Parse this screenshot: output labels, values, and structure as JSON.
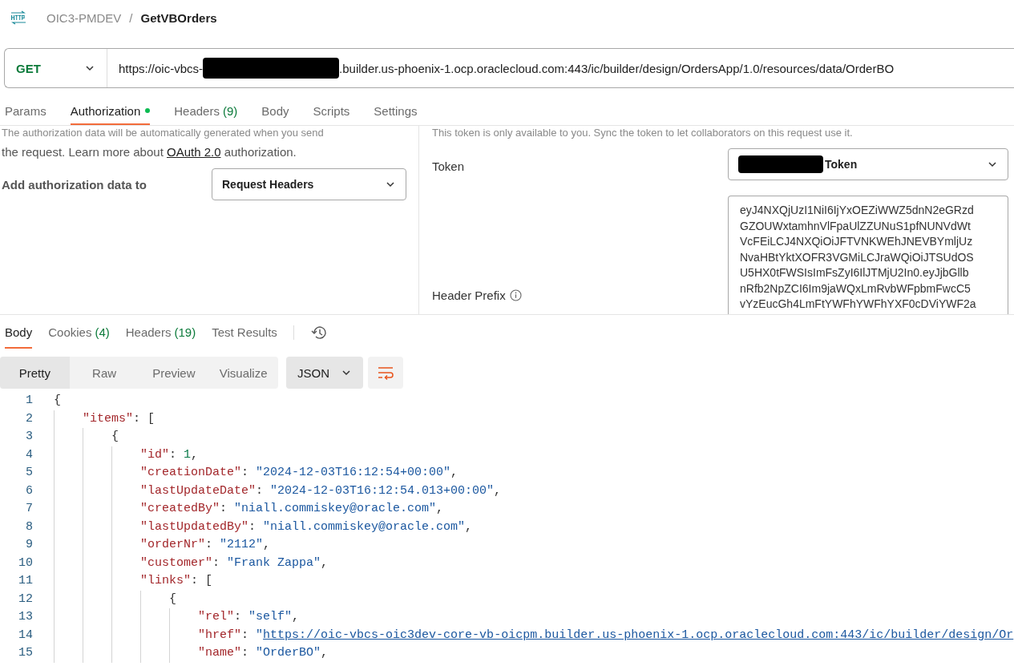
{
  "breadcrumb": {
    "collection": "OIC3-PMDEV",
    "separator": "/",
    "request": "GetVBOrders"
  },
  "request_bar": {
    "method": "GET",
    "url_prefix": "https://oic-vbcs-",
    "url_redacted": true,
    "url_suffix": ".builder.us-phoenix-1.ocp.oraclecloud.com:443/ic/builder/design/OrdersApp/1.0/resources/data/OrderBO"
  },
  "request_tabs": [
    {
      "label": "Params",
      "selected": false,
      "indicator": false
    },
    {
      "label": "Authorization",
      "selected": true,
      "indicator": true
    },
    {
      "label": "Headers",
      "count": "(9)",
      "selected": false,
      "indicator": false
    },
    {
      "label": "Body",
      "selected": false,
      "indicator": false
    },
    {
      "label": "Scripts",
      "selected": false,
      "indicator": false
    },
    {
      "label": "Settings",
      "selected": false,
      "indicator": false
    }
  ],
  "auth": {
    "description_clipped": "The authorization data will be automatically generated when you send",
    "description_before": "the request. Learn more about",
    "description_link": "OAuth 2.0",
    "description_after": "authorization.",
    "add_to_label": "Add authorization data to",
    "add_to_value": "Request Headers",
    "note_clipped": "This token is only available to you. Sync the token to let collaborators on this request use it.",
    "token_label": "Token",
    "token_redacted": true,
    "token_value": "Token",
    "header_prefix_label": "Header Prefix",
    "token_lines": [
      "eyJ4NXQjUzI1NiI6IjYxOEZiWWZ5dnN2eGRzd",
      "GZOUWxtamhnVlFpaUlZZUNuS1pfNUNVdWt",
      "VcFEiLCJ4NXQiOiJFTVNKWEhJNEVBYmljUz",
      "NvaHBtYktXOFR3VGMiLCJraWQiOiJTSUdOS",
      "U5HX0tFWSIsImFsZyI6IlJTMjU2In0.eyJjbGllb",
      "nRfb2NpZCI6Im9jaWQxLmRvbWFpbmFwcC5",
      "vYzEucGh4LmFtYWFhYWFhYXF0cDViYWF2a"
    ]
  },
  "response_tabs": [
    {
      "label": "Body",
      "selected": true
    },
    {
      "label": "Cookies",
      "count": "(4)",
      "selected": false
    },
    {
      "label": "Headers",
      "count": "(19)",
      "selected": false
    },
    {
      "label": "Test Results",
      "selected": false
    }
  ],
  "view_modes": [
    {
      "label": "Pretty",
      "selected": true
    },
    {
      "label": "Raw",
      "selected": false
    },
    {
      "label": "Preview",
      "selected": false
    },
    {
      "label": "Visualize",
      "selected": false
    }
  ],
  "format": "JSON",
  "code_lines": [
    {
      "number": "1",
      "tokens": [
        {
          "kind": "punct",
          "text": "{"
        }
      ]
    },
    {
      "number": "2",
      "tokens": [
        {
          "kind": "key",
          "text": "    \"items\""
        },
        {
          "kind": "punct",
          "text": ": ["
        }
      ]
    },
    {
      "number": "3",
      "tokens": [
        {
          "kind": "punct",
          "text": "        {"
        }
      ]
    },
    {
      "number": "4",
      "tokens": [
        {
          "kind": "key",
          "text": "            \"id\""
        },
        {
          "kind": "punct",
          "text": ": "
        },
        {
          "kind": "number",
          "text": "1"
        },
        {
          "kind": "punct",
          "text": ","
        }
      ]
    },
    {
      "number": "5",
      "tokens": [
        {
          "kind": "key",
          "text": "            \"creationDate\""
        },
        {
          "kind": "punct",
          "text": ": "
        },
        {
          "kind": "string",
          "text": "\"2024-12-03T16:12:54+00:00\""
        },
        {
          "kind": "punct",
          "text": ","
        }
      ]
    },
    {
      "number": "6",
      "tokens": [
        {
          "kind": "key",
          "text": "            \"lastUpdateDate\""
        },
        {
          "kind": "punct",
          "text": ": "
        },
        {
          "kind": "string",
          "text": "\"2024-12-03T16:12:54.013+00:00\""
        },
        {
          "kind": "punct",
          "text": ","
        }
      ]
    },
    {
      "number": "7",
      "tokens": [
        {
          "kind": "key",
          "text": "            \"createdBy\""
        },
        {
          "kind": "punct",
          "text": ": "
        },
        {
          "kind": "string",
          "text": "\"niall.commiskey@oracle.com\""
        },
        {
          "kind": "punct",
          "text": ","
        }
      ]
    },
    {
      "number": "8",
      "tokens": [
        {
          "kind": "key",
          "text": "            \"lastUpdatedBy\""
        },
        {
          "kind": "punct",
          "text": ": "
        },
        {
          "kind": "string",
          "text": "\"niall.commiskey@oracle.com\""
        },
        {
          "kind": "punct",
          "text": ","
        }
      ]
    },
    {
      "number": "9",
      "tokens": [
        {
          "kind": "key",
          "text": "            \"orderNr\""
        },
        {
          "kind": "punct",
          "text": ": "
        },
        {
          "kind": "string",
          "text": "\"2112\""
        },
        {
          "kind": "punct",
          "text": ","
        }
      ]
    },
    {
      "number": "10",
      "tokens": [
        {
          "kind": "key",
          "text": "            \"customer\""
        },
        {
          "kind": "punct",
          "text": ": "
        },
        {
          "kind": "string",
          "text": "\"Frank Zappa\""
        },
        {
          "kind": "punct",
          "text": ","
        }
      ]
    },
    {
      "number": "11",
      "tokens": [
        {
          "kind": "key",
          "text": "            \"links\""
        },
        {
          "kind": "punct",
          "text": ": ["
        }
      ]
    },
    {
      "number": "12",
      "tokens": [
        {
          "kind": "punct",
          "text": "                {"
        }
      ]
    },
    {
      "number": "13",
      "tokens": [
        {
          "kind": "key",
          "text": "                    \"rel\""
        },
        {
          "kind": "punct",
          "text": ": "
        },
        {
          "kind": "string",
          "text": "\"self\""
        },
        {
          "kind": "punct",
          "text": ","
        }
      ]
    },
    {
      "number": "14",
      "tokens": [
        {
          "kind": "key",
          "text": "                    \"href\""
        },
        {
          "kind": "punct",
          "text": ": "
        },
        {
          "kind": "string",
          "text": "\""
        },
        {
          "kind": "link",
          "text": "https://oic-vbcs-oic3dev-core-vb-oicpm.builder.us-phoenix-1.ocp.oraclecloud.com:443/ic/builder/design/Or"
        }
      ]
    },
    {
      "number": "15",
      "tokens": [
        {
          "kind": "key",
          "text": "                    \"name\""
        },
        {
          "kind": "punct",
          "text": ": "
        },
        {
          "kind": "string",
          "text": "\"OrderBO\""
        },
        {
          "kind": "punct",
          "text": ","
        }
      ]
    }
  ]
}
